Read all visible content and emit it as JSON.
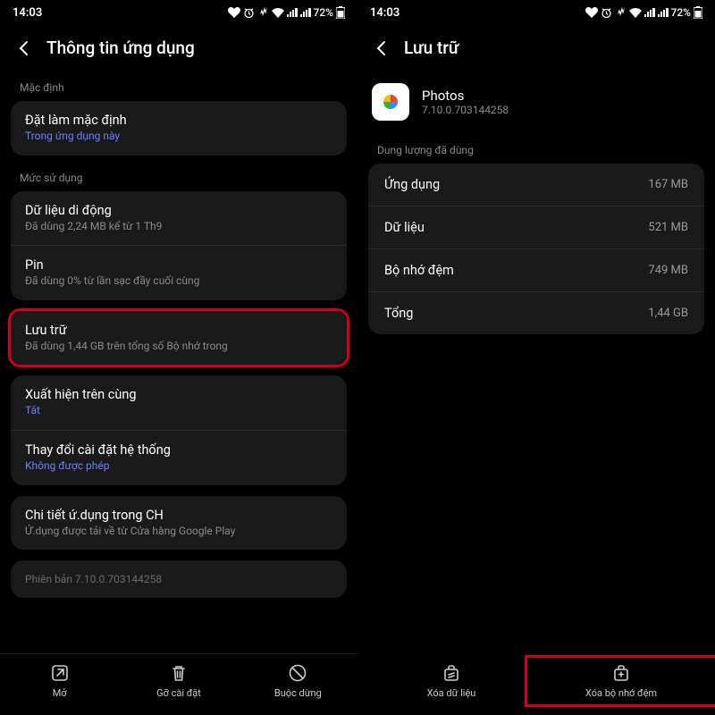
{
  "status": {
    "time": "14:03",
    "battery": "72%"
  },
  "left": {
    "header_title": "Thông tin ứng dụng",
    "section_default": "Mặc định",
    "default_item": {
      "title": "Đặt làm mặc định",
      "sub": "Trong ứng dụng này"
    },
    "section_usage": "Mức sử dụng",
    "mobile_data": {
      "title": "Dữ liệu di động",
      "sub": "Đã dùng 2,24 MB kể từ 1 Th9"
    },
    "battery": {
      "title": "Pin",
      "sub": "Đã dùng 0% từ lần sạc đầy cuối cùng"
    },
    "storage": {
      "title": "Lưu trữ",
      "sub": "Đã dùng 1,44 GB trên tổng số Bộ nhớ trong"
    },
    "appear_top": {
      "title": "Xuất hiện trên cùng",
      "sub": "Tắt"
    },
    "change_sys": {
      "title": "Thay đổi cài đặt hệ thống",
      "sub": "Không được phép"
    },
    "app_details": {
      "title": "Chi tiết ứ.dụng trong CH",
      "sub": "Ứ.dụng được tải về từ Cửa hàng Google Play"
    },
    "version": "Phiên bản 7.10.0.703144258",
    "nav": {
      "open": "Mở",
      "uninstall": "Gỡ cài đặt",
      "force_stop": "Buộc dừng"
    }
  },
  "right": {
    "header_title": "Lưu trữ",
    "app": {
      "name": "Photos",
      "version": "7.10.0.703144258"
    },
    "section_space": "Dung lượng đã dùng",
    "rows": {
      "app": {
        "label": "Ứng dụng",
        "value": "167 MB"
      },
      "data": {
        "label": "Dữ liệu",
        "value": "521 MB"
      },
      "cache": {
        "label": "Bộ nhớ đệm",
        "value": "749 MB"
      },
      "total": {
        "label": "Tổng",
        "value": "1,44 GB"
      }
    },
    "nav": {
      "clear_data": "Xóa dữ liệu",
      "clear_cache": "Xóa bộ nhớ đệm"
    }
  }
}
